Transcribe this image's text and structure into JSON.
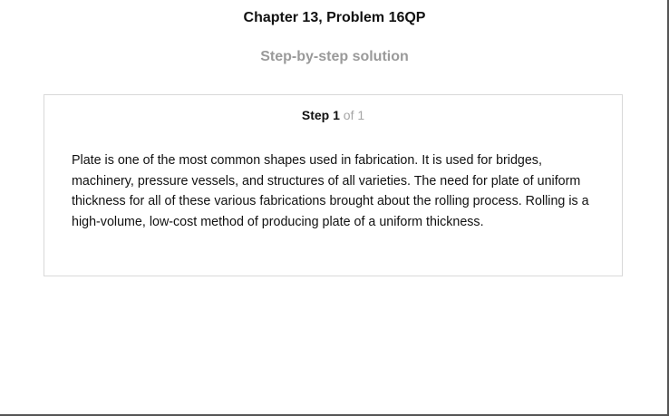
{
  "header": {
    "title": "Chapter 13, Problem 16QP",
    "subtitle": "Step-by-step solution"
  },
  "step": {
    "label": "Step",
    "number": "1",
    "of_total": "of 1",
    "text": "Plate is one of the most common shapes used in fabrication. It is used for bridges, machinery, pressure vessels, and structures of all varieties. The need for plate of uniform thickness for all of these various fabrications brought about the rolling process. Rolling is a high-volume, low-cost method of producing plate of a uniform thickness."
  },
  "colors": {
    "title": "#111111",
    "subtitle": "#9a9a9a",
    "step_of": "#a5a5a5",
    "card_border": "#d9d9d9"
  }
}
